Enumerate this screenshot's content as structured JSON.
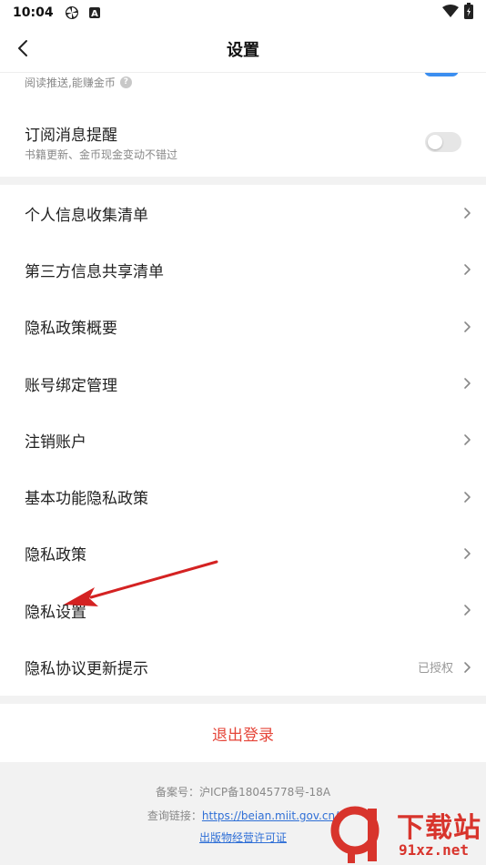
{
  "status_bar": {
    "time": "10:04",
    "icons": [
      "pinwheel-icon",
      "a-box-icon"
    ],
    "right_icons": [
      "wifi-icon",
      "battery-charging-icon"
    ]
  },
  "nav": {
    "title": "设置",
    "back_icon": "chevron-left-icon"
  },
  "top_section": {
    "cut_text": "阅读推送,能赚金币",
    "subscription": {
      "title": "订阅消息提醒",
      "desc": "书籍更新、金币现金变动不错过",
      "enabled": false
    }
  },
  "list": {
    "items": [
      {
        "label": "个人信息收集清单",
        "extra": ""
      },
      {
        "label": "第三方信息共享清单",
        "extra": ""
      },
      {
        "label": "隐私政策概要",
        "extra": ""
      },
      {
        "label": "账号绑定管理",
        "extra": ""
      },
      {
        "label": "注销账户",
        "extra": ""
      },
      {
        "label": "基本功能隐私政策",
        "extra": ""
      },
      {
        "label": "隐私政策",
        "extra": ""
      },
      {
        "label": "隐私设置",
        "extra": ""
      },
      {
        "label": "隐私协议更新提示",
        "extra": "已授权"
      }
    ]
  },
  "logout": {
    "label": "退出登录"
  },
  "footer": {
    "record_label": "备案号：",
    "record_value": "沪ICP备18045778号-18A",
    "query_label": "查询链接：",
    "query_link": "https://beian.miit.gov.cn/",
    "license_link": "出版物经营许可证"
  },
  "watermark": {
    "title": "下载站",
    "sub": "91xz.net"
  },
  "colors": {
    "accent_red": "#e5463a",
    "toggle_on": "#3b8ef0",
    "link_blue": "#2f6fd6"
  }
}
